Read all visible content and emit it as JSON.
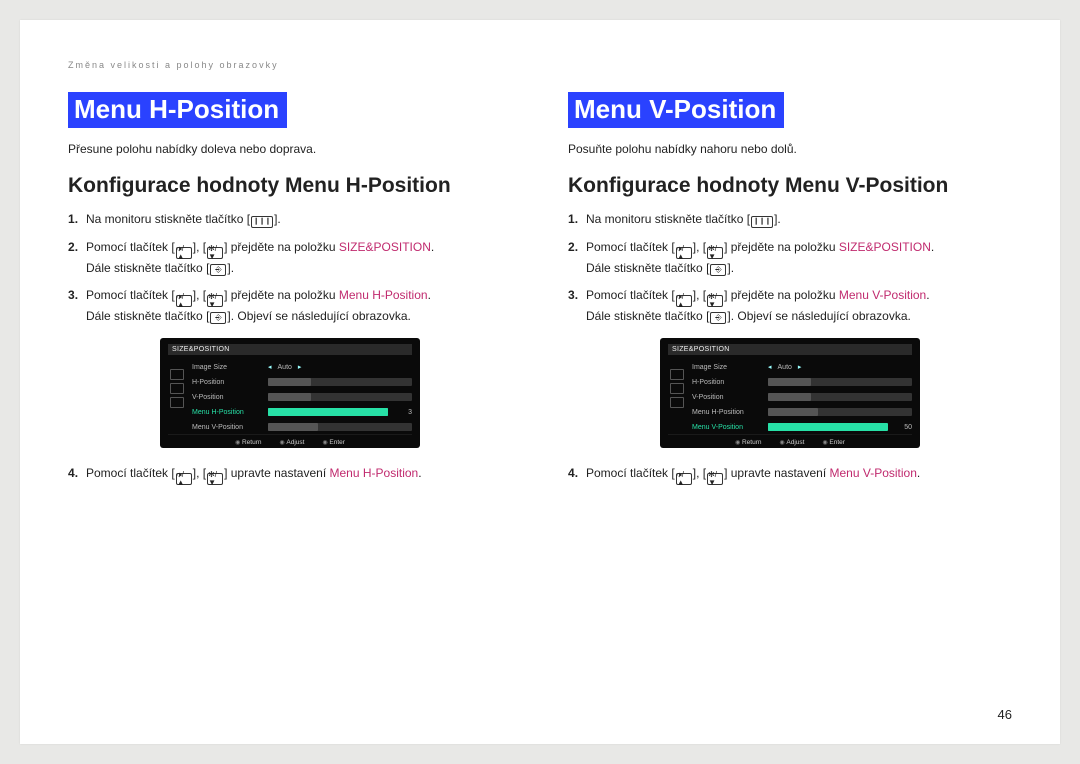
{
  "breadcrumb": "Změna velikosti a polohy obrazovky",
  "page_number": "46",
  "icons": {
    "menu": "▥",
    "sound_up": "🔈/▲",
    "bright_dn": "☼/▼",
    "enter": "⏎"
  },
  "osd": {
    "header": "SIZE&POSITION",
    "foot": [
      "Return",
      "Adjust",
      "Enter"
    ],
    "rows_h": [
      {
        "label": "Image Size",
        "val": "Auto"
      },
      {
        "label": "H-Position",
        "slider": true,
        "fill": 30
      },
      {
        "label": "V-Position",
        "slider": true,
        "fill": 30
      },
      {
        "label": "Menu H-Position",
        "slider": true,
        "hl": true,
        "fill": 100,
        "num": "3"
      },
      {
        "label": "Menu V-Position",
        "slider": true,
        "fill": 35
      }
    ],
    "rows_v": [
      {
        "label": "Image Size",
        "val": "Auto"
      },
      {
        "label": "H-Position",
        "slider": true,
        "fill": 30
      },
      {
        "label": "V-Position",
        "slider": true,
        "fill": 30
      },
      {
        "label": "Menu H-Position",
        "slider": true,
        "fill": 35
      },
      {
        "label": "Menu V-Position",
        "slider": true,
        "hl": true,
        "fill": 95,
        "num": "50"
      }
    ]
  },
  "left": {
    "title": "Menu H-Position",
    "intro": "Přesune polohu nabídky doleva nebo doprava.",
    "subhead": "Konfigurace hodnoty Menu H-Position",
    "steps": [
      {
        "parts": [
          {
            "t": "Na monitoru stiskněte tlačítko "
          },
          {
            "ico": "menu"
          },
          {
            "t": "."
          }
        ]
      },
      {
        "parts": [
          {
            "t": "Pomocí tlačítek "
          },
          {
            "ico": "sound_up"
          },
          {
            "t": ", "
          },
          {
            "ico": "bright_dn"
          },
          {
            "t": " přejděte na položku "
          },
          {
            "sp": "SIZE&POSITION"
          },
          {
            "t": "."
          }
        ],
        "cont": [
          {
            "t": "Dále stiskněte tlačítko "
          },
          {
            "ico": "enter"
          },
          {
            "t": "."
          }
        ]
      },
      {
        "parts": [
          {
            "t": "Pomocí tlačítek "
          },
          {
            "ico": "sound_up"
          },
          {
            "t": ", "
          },
          {
            "ico": "bright_dn"
          },
          {
            "t": " přejděte na položku "
          },
          {
            "mp": "Menu H-Position"
          },
          {
            "t": "."
          }
        ],
        "cont": [
          {
            "t": "Dále stiskněte tlačítko "
          },
          {
            "ico": "enter"
          },
          {
            "t": ". Objeví se následující obrazovka."
          }
        ],
        "osd": "rows_h"
      },
      {
        "parts": [
          {
            "t": "Pomocí tlačítek "
          },
          {
            "ico": "sound_up"
          },
          {
            "t": ", "
          },
          {
            "ico": "bright_dn"
          },
          {
            "t": " upravte nastavení "
          },
          {
            "mp": "Menu H-Position"
          },
          {
            "t": "."
          }
        ]
      }
    ]
  },
  "right": {
    "title": "Menu V-Position",
    "intro": "Posuňte polohu nabídky nahoru nebo dolů.",
    "subhead": "Konfigurace hodnoty Menu V-Position",
    "steps": [
      {
        "parts": [
          {
            "t": "Na monitoru stiskněte tlačítko "
          },
          {
            "ico": "menu"
          },
          {
            "t": "."
          }
        ]
      },
      {
        "parts": [
          {
            "t": "Pomocí tlačítek "
          },
          {
            "ico": "sound_up"
          },
          {
            "t": ", "
          },
          {
            "ico": "bright_dn"
          },
          {
            "t": " přejděte na položku "
          },
          {
            "sp": "SIZE&POSITION"
          },
          {
            "t": "."
          }
        ],
        "cont": [
          {
            "t": "Dále stiskněte tlačítko "
          },
          {
            "ico": "enter"
          },
          {
            "t": "."
          }
        ]
      },
      {
        "parts": [
          {
            "t": "Pomocí tlačítek "
          },
          {
            "ico": "sound_up"
          },
          {
            "t": ", "
          },
          {
            "ico": "bright_dn"
          },
          {
            "t": " přejděte na položku "
          },
          {
            "mp": "Menu V-Position"
          },
          {
            "t": "."
          }
        ],
        "cont": [
          {
            "t": "Dále stiskněte tlačítko "
          },
          {
            "ico": "enter"
          },
          {
            "t": ".  Objeví se následující obrazovka."
          }
        ],
        "osd": "rows_v"
      },
      {
        "parts": [
          {
            "t": "Pomocí tlačítek "
          },
          {
            "ico": "sound_up"
          },
          {
            "t": ", "
          },
          {
            "ico": "bright_dn"
          },
          {
            "t": " upravte nastavení "
          },
          {
            "mp": "Menu V-Position"
          },
          {
            "t": "."
          }
        ]
      }
    ]
  }
}
